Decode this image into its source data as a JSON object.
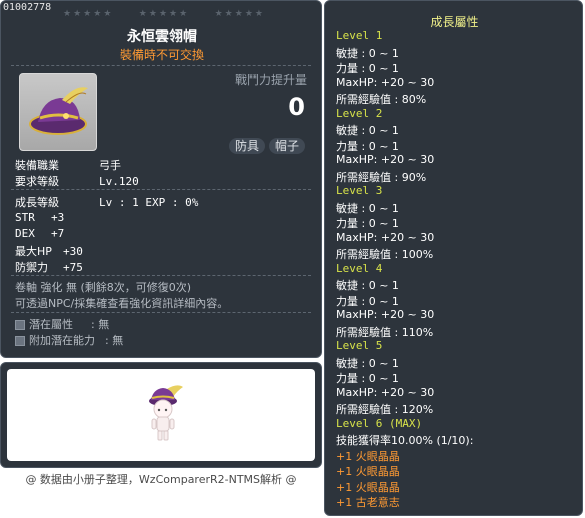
{
  "item": {
    "id": "01002778",
    "name": "永恒雲翎帽",
    "trade_note": "裝備時不可交換",
    "power_label": "戰鬥力提升量",
    "power_value": "0",
    "tags": [
      "防具",
      "帽子"
    ],
    "job_label": "裝備職業",
    "job_value": "弓手",
    "req_level_label": "要求等級",
    "req_level_value": "Lv.120",
    "growth_label": "成長等級",
    "growth_value": "Lv  :  1   EXP  :  0%",
    "stats": [
      {
        "label": "STR",
        "value": "+3"
      },
      {
        "label": "DEX",
        "value": "+7"
      },
      {
        "label": "最大HP",
        "value": "+30"
      },
      {
        "label": "防禦力",
        "value": "+75"
      }
    ],
    "scroll_text": "卷軸 強化 無 (剩餘8次，可修復0次)",
    "npc_text": "可透過NPC/採集確查看強化資訊詳細內容。",
    "potential_label": "潛在屬性",
    "potential_value": ":  無",
    "add_potential_label": "附加潛在能力",
    "add_potential_value": ":  無"
  },
  "footer": "@ 数据由小册子整理，WzComparerR2-NTMS解析 @",
  "growth": {
    "title": "成長屬性",
    "levels": [
      {
        "name": "Level 1",
        "lines": [
          "敏捷 : 0 ~ 1",
          "力量 : 0 ~ 1",
          "MaxHP:  +20 ~ 30",
          "所需經驗值 : 80%"
        ]
      },
      {
        "name": "Level 2",
        "lines": [
          "敏捷 : 0 ~ 1",
          "力量 : 0 ~ 1",
          "MaxHP:  +20 ~ 30",
          "所需經驗值 : 90%"
        ]
      },
      {
        "name": "Level 3",
        "lines": [
          "敏捷 : 0 ~ 1",
          "力量 : 0 ~ 1",
          "MaxHP:  +20 ~ 30",
          "所需經驗值 : 100%"
        ]
      },
      {
        "name": "Level 4",
        "lines": [
          "敏捷 : 0 ~ 1",
          "力量 : 0 ~ 1",
          "MaxHP:  +20 ~ 30",
          "所需經驗值 : 110%"
        ]
      },
      {
        "name": "Level 5",
        "lines": [
          "敏捷 : 0 ~ 1",
          "力量 : 0 ~ 1",
          "MaxHP:  +20 ~ 30",
          "所需經驗值 : 120%"
        ]
      }
    ],
    "max_level": "Level 6 (MAX)",
    "skill_rate": "技能獲得率10.00% (1/10):",
    "skills": [
      "+1 火眼晶晶",
      "+1 火眼晶晶",
      "+1 火眼晶晶",
      "+1 古老意志"
    ]
  }
}
